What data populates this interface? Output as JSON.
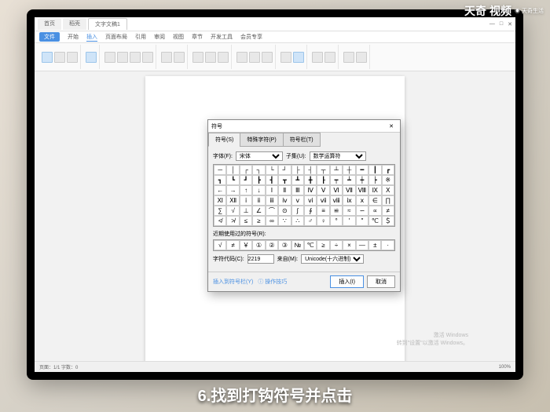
{
  "logo": {
    "brand": "天奇",
    "sub": "视频",
    "tag": "天奇生活"
  },
  "caption": "6.找到打钩符号并点击",
  "titlebar": {
    "tab1": "首页",
    "tab2": "稻壳",
    "tab3": "文字文稿1"
  },
  "ribbon_tabs": [
    "文件",
    "开始",
    "插入",
    "页面布局",
    "引用",
    "审阅",
    "视图",
    "章节",
    "开发工具",
    "会员专享"
  ],
  "dialog": {
    "title": "符号",
    "tabs": [
      "符号(S)",
      "特殊字符(P)",
      "符号栏(T)"
    ],
    "font_label": "字体(F):",
    "font_value": "宋体",
    "subset_label": "子集(U):",
    "subset_value": "数学运算符",
    "recent_label": "近期使用过的符号(R):",
    "code_label": "字符代码(C):",
    "code_value": "2219",
    "from_label": "来自(M):",
    "from_value": "Unicode(十六进制)",
    "link1": "插入到符号栏(Y)",
    "link2": "操作技巧",
    "btn_insert": "插入(I)",
    "btn_cancel": "取消"
  },
  "symbols_grid": [
    "─",
    "│",
    "┌",
    "┐",
    "└",
    "┘",
    "├",
    "┤",
    "┬",
    "┴",
    "┼",
    "━",
    "┃",
    "┏",
    "┓",
    "┗",
    "┛",
    "┣",
    "┫",
    "┳",
    "┻",
    "╋",
    "┠",
    "┯",
    "┷",
    "┿",
    "┝",
    "※",
    "←",
    "→",
    "↑",
    "↓",
    "Ⅰ",
    "Ⅱ",
    "Ⅲ",
    "Ⅳ",
    "Ⅴ",
    "Ⅵ",
    "Ⅶ",
    "Ⅷ",
    "Ⅸ",
    "Ⅹ",
    "Ⅺ",
    "Ⅻ",
    "ⅰ",
    "ⅱ",
    "ⅲ",
    "ⅳ",
    "ⅴ",
    "ⅵ",
    "ⅶ",
    "ⅷ",
    "ⅸ",
    "ⅹ",
    "∈",
    "∏",
    "∑",
    "√",
    "⊥",
    "∠",
    "⌒",
    "⊙",
    "∫",
    "∮",
    "≡",
    "≌",
    "≈",
    "∽",
    "∝",
    "≠",
    "≮",
    "≯",
    "≤",
    "≥",
    "∞",
    "∵",
    "∴",
    "♂",
    "♀",
    "°",
    "′",
    "″",
    "℃",
    "＄"
  ],
  "symbols_recent": [
    "√",
    "≠",
    "￥",
    "①",
    "②",
    "③",
    "№",
    "℃",
    "≥",
    "÷",
    "×",
    "—",
    "±",
    "·"
  ],
  "watermark": {
    "l1": "激活 Windows",
    "l2": "转到\"设置\"以激活 Windows。"
  },
  "status": {
    "left": "页面：1/1  字数：0",
    "zoom": "100%"
  }
}
